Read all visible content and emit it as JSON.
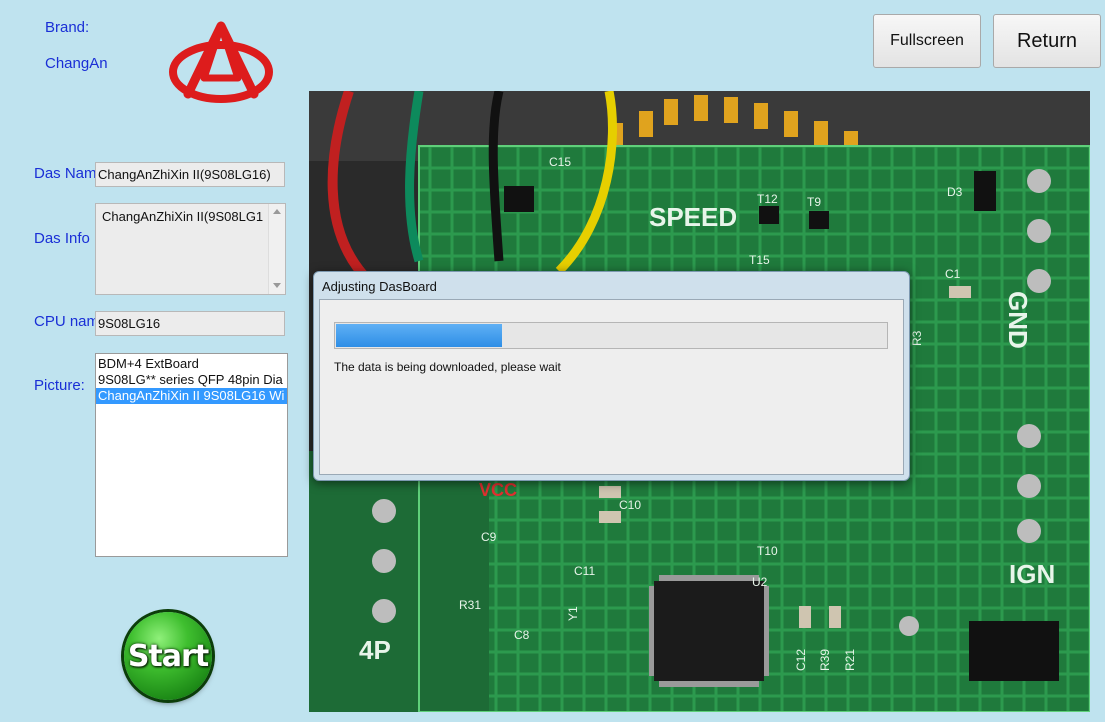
{
  "brand": {
    "label": "Brand:",
    "value": "ChangAn"
  },
  "colors": {
    "accent": "#3399ff",
    "label_text": "#1a2fd6",
    "logo": "#dd1c1c",
    "progress": "#2e8ee6",
    "start_button": "#2aa322"
  },
  "form": {
    "das_name_label": "Das Nam",
    "das_name_value": "ChangAnZhiXin II(9S08LG16)",
    "das_info_label": "Das Info",
    "das_info_value": "ChangAnZhiXin II(9S08LG1",
    "cpu_name_label": "CPU nam",
    "cpu_name_value": "9S08LG16",
    "picture_label": "Picture:",
    "picture_items": [
      "BDM+4 ExtBoard",
      "9S08LG** series QFP 48pin Dia",
      "ChangAnZhiXin II 9S08LG16 Wi"
    ],
    "picture_selected_index": 2
  },
  "toolbar": {
    "fullscreen_label": "Fullscreen",
    "return_label": "Return"
  },
  "start_label": "Start",
  "pcb_labels": {
    "speed": "SPEED",
    "gnd": "GND",
    "ign": "IGN",
    "vcc": "VCC",
    "p4": "4P",
    "c15": "C15",
    "t12": "T12",
    "t9": "T9",
    "t15": "T15",
    "d3": "D3",
    "c1": "C1",
    "r3": "R3",
    "c10": "C10",
    "c9": "C9",
    "c11": "C11",
    "t10": "T10",
    "u2": "U2",
    "r31": "R31",
    "c8": "C8",
    "y1": "Y1",
    "c12": "C12",
    "r39": "R39",
    "r21": "R21"
  },
  "dialog": {
    "title": "Adjusting DasBoard",
    "message": "The data is being downloaded, please wait",
    "progress_fraction": 0.3
  }
}
